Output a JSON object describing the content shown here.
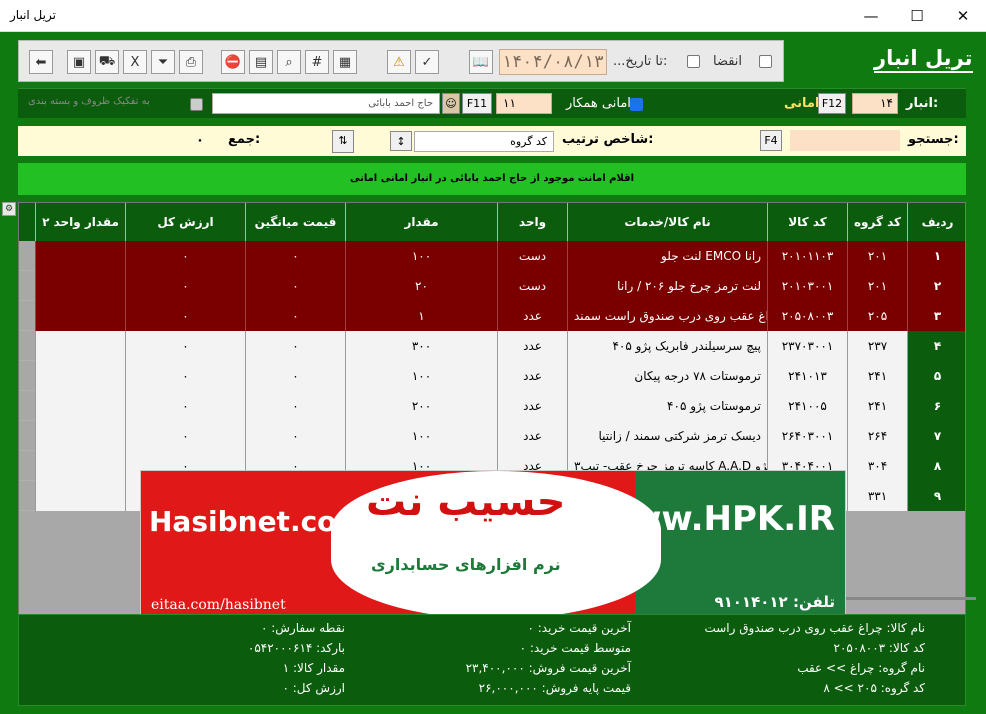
{
  "window": {
    "title": "تریل انبار"
  },
  "form_title": "تریل انبار",
  "toolbar": {
    "expire_label": "انقضا",
    "to_date_label": "...تا تاریخ:",
    "date_value": "۱۴۰۴/۰۸/۱۳",
    "hash_label": "#"
  },
  "warehouse": {
    "label": "انبار:",
    "number": "۱۴",
    "fkey": "F12",
    "type": "امانی",
    "partner_label": "امانی همکار:",
    "partner_code": "۱۱",
    "partner_fkey": "F11",
    "partner_name": "حاج احمد بابائی",
    "separate_label": "به تفکیک ظروف و بسته بندی"
  },
  "search": {
    "label": "جستجو:",
    "fkey": "F4",
    "sort_label": "شاخص ترتیب:",
    "sort_value": "کد گروه",
    "sum_label": "جمع:",
    "sum_value": "۰"
  },
  "banner_text": "اقلام امانت موجود از حاج احمد بابائی در انبار امانی امانی",
  "table": {
    "headers": [
      "ردیف",
      "کد گروه",
      "کد کالا",
      "نام کالا/خدمات",
      "واحد",
      "مقدار",
      "قیمت میانگین",
      "ارزش کل",
      "مقدار واحد ۲"
    ],
    "rows": [
      {
        "row": "۱",
        "group": "۲۰۱",
        "code": "۲۰۱۰۱۱۰۳",
        "name": "لنت جلو EMCO رانا",
        "unit": "دست",
        "qty": "۱۰۰",
        "avg": "۰",
        "total": "۰",
        "qty2": ""
      },
      {
        "row": "۲",
        "group": "۲۰۱",
        "code": "۲۰۱۰۳۰۰۱",
        "name": "لنت ترمز چرخ جلو ۲۰۶ / رانا",
        "unit": "دست",
        "qty": "۲۰",
        "avg": "۰",
        "total": "۰",
        "qty2": ""
      },
      {
        "row": "۳",
        "group": "۲۰۵",
        "code": "۲۰۵۰۸۰۰۳",
        "name": "چراغ عقب روی درب صندوق راست سمند",
        "unit": "عدد",
        "qty": "۱",
        "avg": "۰",
        "total": "۰",
        "qty2": ""
      },
      {
        "row": "۴",
        "group": "۲۳۷",
        "code": "۲۳۷۰۳۰۰۱",
        "name": "پیچ سرسیلندر فابریک پژو ۴۰۵",
        "unit": "عدد",
        "qty": "۳۰۰",
        "avg": "۰",
        "total": "۰",
        "qty2": ""
      },
      {
        "row": "۵",
        "group": "۲۴۱",
        "code": "۲۴۱۰۱۳",
        "name": "ترموستات ۷۸ درجه پیکان",
        "unit": "عدد",
        "qty": "۱۰۰",
        "avg": "۰",
        "total": "۰",
        "qty2": ""
      },
      {
        "row": "۶",
        "group": "۲۴۱",
        "code": "۲۴۱۰۰۵",
        "name": "ترموستات پژو ۴۰۵",
        "unit": "عدد",
        "qty": "۲۰۰",
        "avg": "۰",
        "total": "۰",
        "qty2": ""
      },
      {
        "row": "۷",
        "group": "۲۶۴",
        "code": "۲۶۴۰۳۰۰۱",
        "name": "دیسک ترمز شرکتی سمند / زانتیا",
        "unit": "عدد",
        "qty": "۱۰۰",
        "avg": "۰",
        "total": "۰",
        "qty2": ""
      },
      {
        "row": "۸",
        "group": "۳۰۴",
        "code": "۳۰۴۰۴۰۰۱",
        "name": "کاسه ترمز چرخ عقب- تیپ۳ A.A.D پژو...",
        "unit": "عدد",
        "qty": "۱۰۰",
        "avg": "۰",
        "total": "۰",
        "qty2": ""
      },
      {
        "row": "۹",
        "group": "۳۳۱",
        "code": "",
        "name": "",
        "unit": "",
        "qty": "",
        "avg": "",
        "total": "",
        "qty2": ""
      }
    ]
  },
  "ad": {
    "site": "Hasibnet.com",
    "eitaa": "eitaa.com/hasibnet",
    "logo": "حسیب نت",
    "subtitle": "نرم افزارهای حسابداری",
    "hpk": "www.HPK.IR",
    "phone": "تلفن: ۹۱۰۱۴۰۱۲"
  },
  "info": {
    "product_name": "نام کالا: چراغ عقب روی درب صندوق راست",
    "product_code": "کد کالا: ۲۰۵۰۸۰۰۳",
    "group_name": "نام گروه: چراغ >> عقب",
    "group_code": "کد گروه: ۲۰۵ >> ۸",
    "last_buy": "آخرین قیمت خرید: ۰",
    "avg_buy": "متوسط قیمت خرید: ۰",
    "last_sell": "آخرین قیمت فروش: ۲۳,۴۰۰,۰۰۰",
    "base_sell": "قیمت پایه فروش: ۲۶,۰۰۰,۰۰۰",
    "reorder": "نقطه سفارش: ۰",
    "barcode": "بارکد: ۰۵۴۲۰۰۰۶۱۴",
    "qty": "مقدار کالا: ۱",
    "total": "ارزش کل: ۰"
  }
}
